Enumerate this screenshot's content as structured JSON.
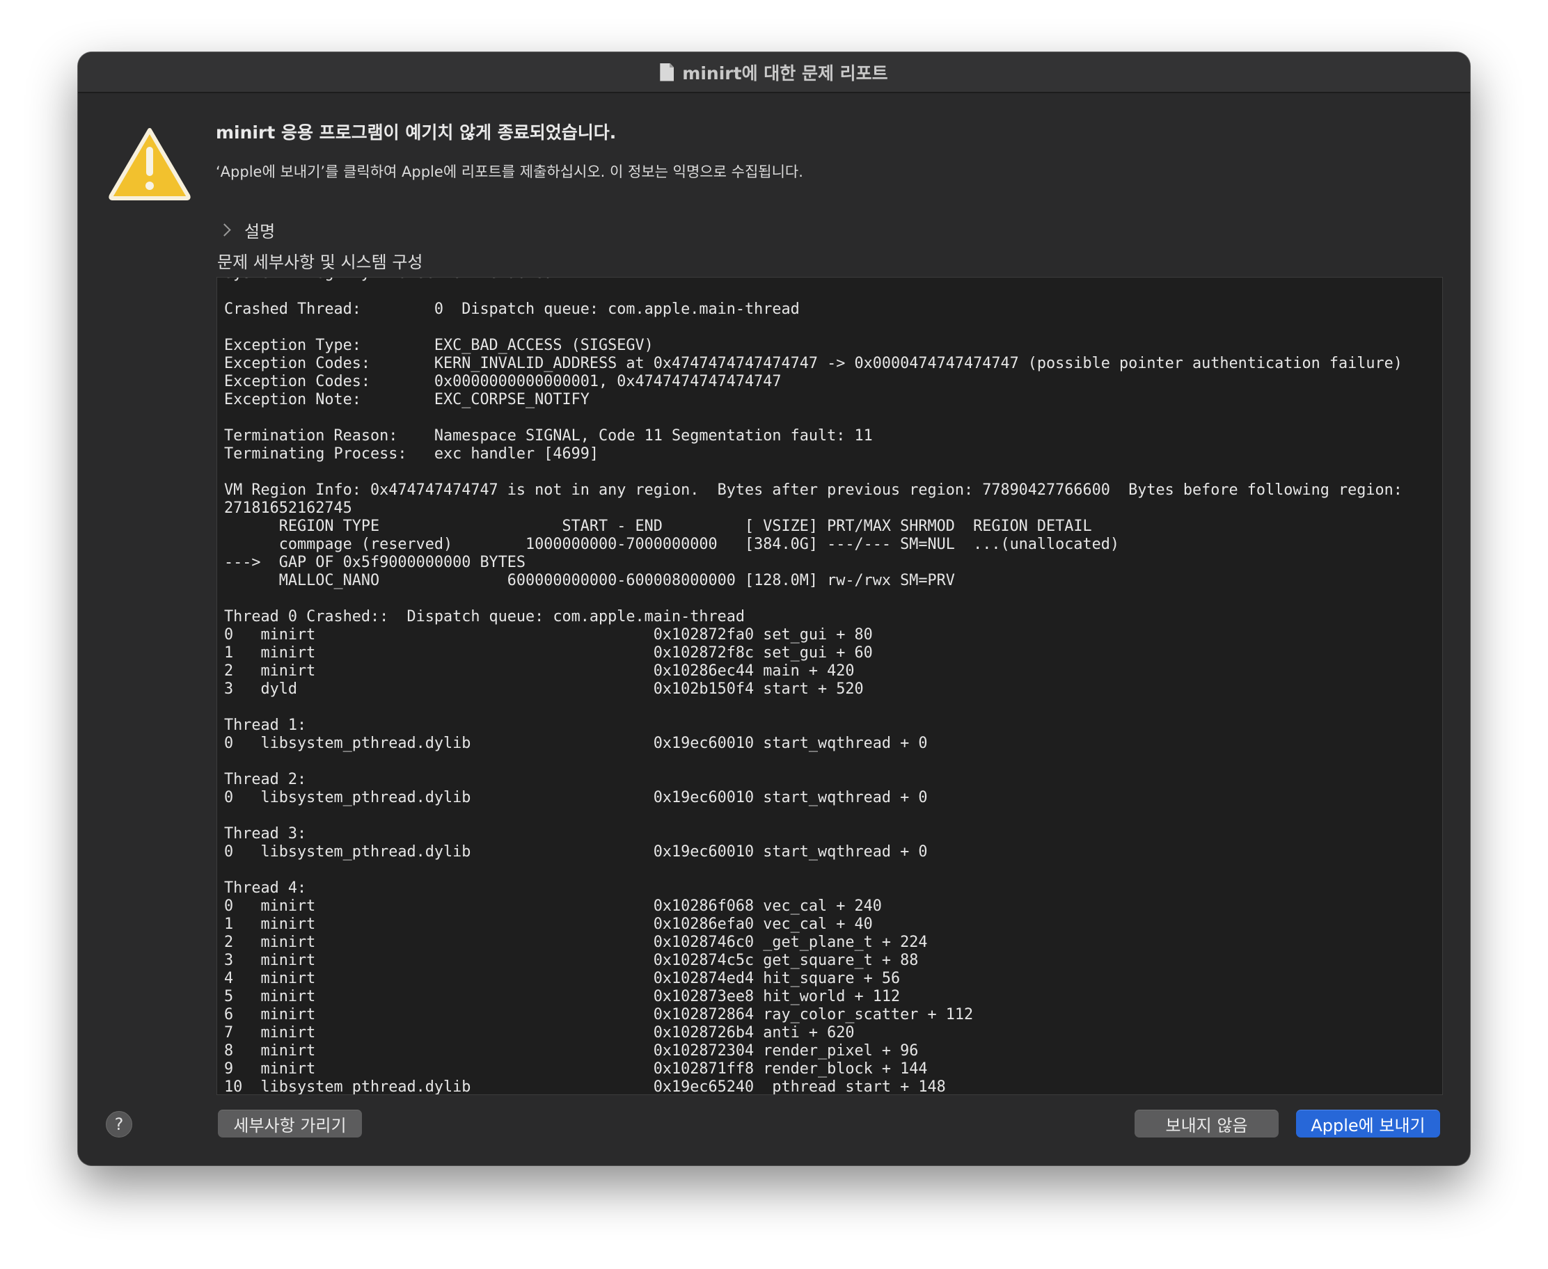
{
  "window": {
    "title": "minirt에 대한 문제 리포트"
  },
  "alert": {
    "icon": "warning-triangle-icon",
    "heading": "minirt 응용 프로그램이 예기치 않게 종료되었습니다.",
    "message": "‘Apple에 보내기’를 클릭하여 Apple에 리포트를 제출하십시오. 이 정보는 익명으로 수집됩니다."
  },
  "description": {
    "label": "설명"
  },
  "details": {
    "section_label": "문제 세부사항 및 시스템 구성",
    "report_text": "System Integrity Protection: enabled\n\nCrashed Thread:        0  Dispatch queue: com.apple.main-thread\n\nException Type:        EXC_BAD_ACCESS (SIGSEGV)\nException Codes:       KERN_INVALID_ADDRESS at 0x4747474747474747 -> 0x0000474747474747 (possible pointer authentication failure)\nException Codes:       0x0000000000000001, 0x4747474747474747\nException Note:        EXC_CORPSE_NOTIFY\n\nTermination Reason:    Namespace SIGNAL, Code 11 Segmentation fault: 11\nTerminating Process:   exc handler [4699]\n\nVM Region Info: 0x474747474747 is not in any region.  Bytes after previous region: 77890427766600  Bytes before following region:\n27181652162745\n      REGION TYPE                    START - END         [ VSIZE] PRT/MAX SHRMOD  REGION DETAIL\n      commpage (reserved)        1000000000-7000000000   [384.0G] ---/--- SM=NUL  ...(unallocated)\n--->  GAP OF 0x5f9000000000 BYTES\n      MALLOC_NANO              600000000000-600008000000 [128.0M] rw-/rwx SM=PRV\n\nThread 0 Crashed::  Dispatch queue: com.apple.main-thread\n0   minirt                        \t       0x102872fa0 set_gui + 80\n1   minirt                        \t       0x102872f8c set_gui + 60\n2   minirt                        \t       0x10286ec44 main + 420\n3   dyld                          \t       0x102b150f4 start + 520\n\nThread 1:\n0   libsystem_pthread.dylib       \t       0x19ec60010 start_wqthread + 0\n\nThread 2:\n0   libsystem_pthread.dylib       \t       0x19ec60010 start_wqthread + 0\n\nThread 3:\n0   libsystem_pthread.dylib       \t       0x19ec60010 start_wqthread + 0\n\nThread 4:\n0   minirt                        \t       0x10286f068 vec_cal + 240\n1   minirt                        \t       0x10286efa0 vec_cal + 40\n2   minirt                        \t       0x1028746c0 _get_plane_t + 224\n3   minirt                        \t       0x102874c5c get_square_t + 88\n4   minirt                        \t       0x102874ed4 hit_square + 56\n5   minirt                        \t       0x102873ee8 hit_world + 112\n6   minirt                        \t       0x102872864 ray_color_scatter + 112\n7   minirt                        \t       0x1028726b4 anti + 620\n8   minirt                        \t       0x102872304 render_pixel + 96\n9   minirt                        \t       0x102871ff8 render_block + 144\n10  libsystem_pthread.dylib       \t       0x19ec65240 _pthread_start + 148"
  },
  "footer": {
    "help_label": "?",
    "hide_details_label": "세부사항 가리기",
    "dont_send_label": "보내지 않음",
    "send_label": "Apple에 보내기"
  },
  "colors": {
    "window_bg": "#2a2a2b",
    "accent": "#2767d8",
    "warning": "#f2c12e"
  }
}
